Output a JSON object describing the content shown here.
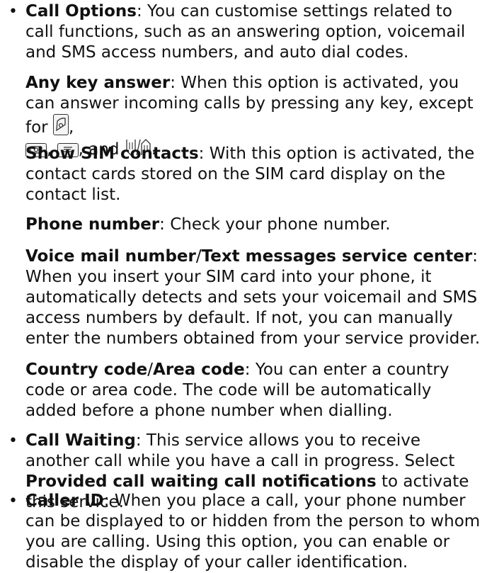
{
  "call_options": {
    "title": "Call Options",
    "text": ": You can customise settings related to call functions, such as an answering option, voicemail and SMS access numbers, and auto dial codes."
  },
  "any_key_answer": {
    "title": "Any key answer",
    "text_before": ": When this option is activated, you can answer incoming calls by pressing any key, except for",
    "comma1": ",",
    "comma2": ",",
    "and_text": ", and",
    "period": ".",
    "key_icons": [
      "end-call-key-icon",
      "camera-key-icon",
      "menu-key-icon",
      "volume-keys-icon"
    ]
  },
  "show_sim_contacts": {
    "title": "Show SIM contacts",
    "text": ": With this option is activated, the contact cards stored on the SIM card display on the contact list."
  },
  "phone_number": {
    "title": "Phone number",
    "text": ": Check your phone number."
  },
  "voice_mail": {
    "title1": "Voice mail number",
    "slash": "/",
    "title2": "Text messages service center",
    "text": ": When you insert your SIM card into your phone, it automatically detects and sets your voicemail and SMS access numbers by default. If not, you can manually enter the numbers obtained from your service provider."
  },
  "country_code": {
    "title1": "Country code",
    "slash": "/",
    "title2": "Area code",
    "text": ": You can enter a country code or area code. The code will be automatically added before a phone number when dialling."
  },
  "call_waiting": {
    "title": "Call Waiting",
    "text_before": ": This service allows you to receive another call while you have a call in progress. Select",
    "bold_option": "Provided call waiting call notifications",
    "text_after": " to activate this service."
  },
  "caller_id": {
    "title": "Caller ID",
    "text": ": When you place a call, your phone number can be displayed to or hidden from the person to whom you are calling. Using this option, you can enable or disable the display of your caller identification."
  }
}
